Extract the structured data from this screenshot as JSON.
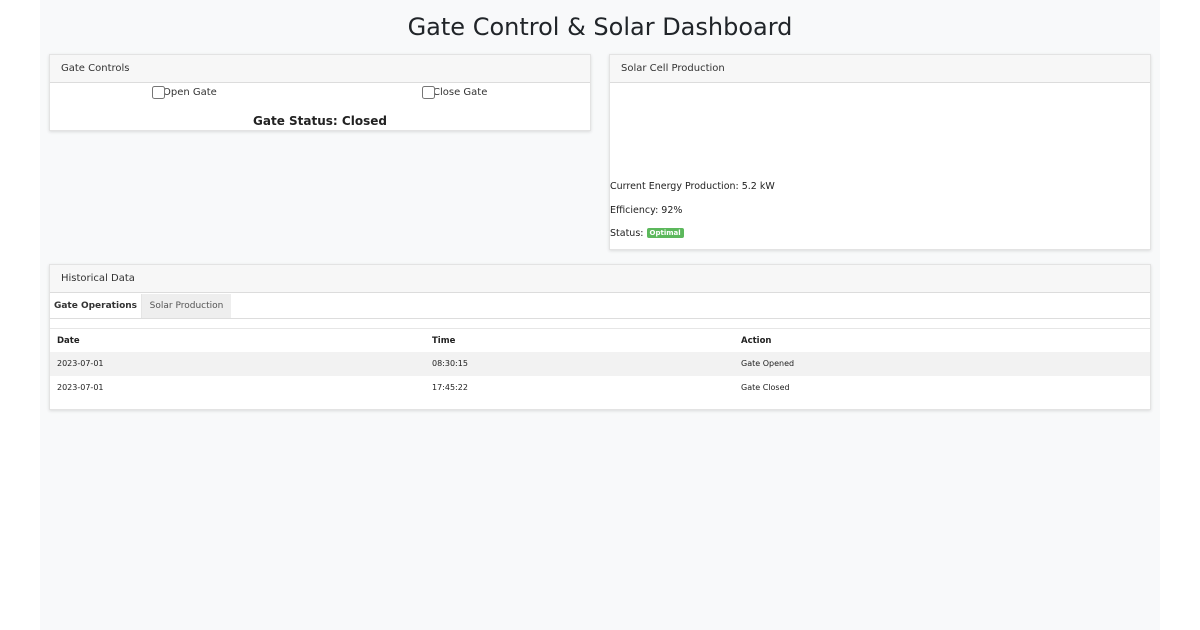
{
  "page": {
    "title": "Gate Control & Solar Dashboard"
  },
  "gate_controls": {
    "header": "Gate Controls",
    "open_label": "Open Gate",
    "close_label": "Close Gate",
    "open_checked": false,
    "close_checked": false,
    "status_text": "Gate Status: Closed"
  },
  "solar": {
    "header": "Solar Cell Production",
    "energy_text": "Current Energy Production: 5.2 kW",
    "efficiency_text": "Efficiency: 92%",
    "status_label": "Status:",
    "status_badge": "Optimal",
    "badge_color": "#5cb85c"
  },
  "history": {
    "header": "Historical Data",
    "tabs": [
      {
        "label": "Gate Operations",
        "active": true
      },
      {
        "label": "Solar Production",
        "active": false
      }
    ],
    "columns": [
      "Date",
      "Time",
      "Action"
    ],
    "rows": [
      {
        "date": "2023-07-01",
        "time": "08:30:15",
        "action": "Gate Opened"
      },
      {
        "date": "2023-07-01",
        "time": "17:45:22",
        "action": "Gate Closed"
      }
    ]
  }
}
